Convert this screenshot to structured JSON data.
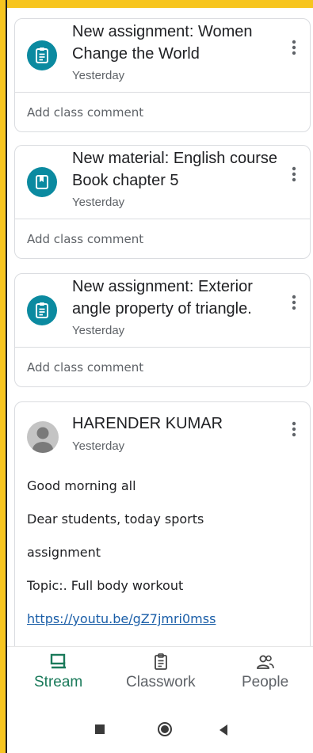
{
  "stream": {
    "items": [
      {
        "type": "assignment",
        "icon": "assignment-icon",
        "title": "New assignment: Women Change the World",
        "time": "Yesterday",
        "comment_placeholder": "Add class comment"
      },
      {
        "type": "material",
        "icon": "material-book-icon",
        "title": "New material: English course Book chapter 5",
        "time": "Yesterday",
        "comment_placeholder": "Add class comment"
      },
      {
        "type": "assignment",
        "icon": "assignment-icon",
        "title": "New assignment: Exterior angle property of triangle.",
        "time": "Yesterday",
        "comment_placeholder": "Add class comment"
      }
    ],
    "post": {
      "author": "HARENDER KUMAR",
      "time": "Yesterday",
      "lines": [
        "Good morning all",
        "Dear students, today sports",
        "assignment",
        "Topic:. Full body workout"
      ],
      "link": "https://youtu.be/gZ7jmri0mss"
    }
  },
  "bottom_nav": {
    "items": [
      {
        "label": "Stream",
        "icon": "stream-icon",
        "active": true
      },
      {
        "label": "Classwork",
        "icon": "classwork-icon",
        "active": false
      },
      {
        "label": "People",
        "icon": "people-icon",
        "active": false
      }
    ]
  },
  "system_nav": [
    "recents-square-icon",
    "home-circle-icon",
    "back-triangle-icon"
  ],
  "colors": {
    "frame": "#f7c51f",
    "accent_teal": "#0b8aa0",
    "active_green": "#1a7a5a",
    "link": "#1a5ea8"
  }
}
